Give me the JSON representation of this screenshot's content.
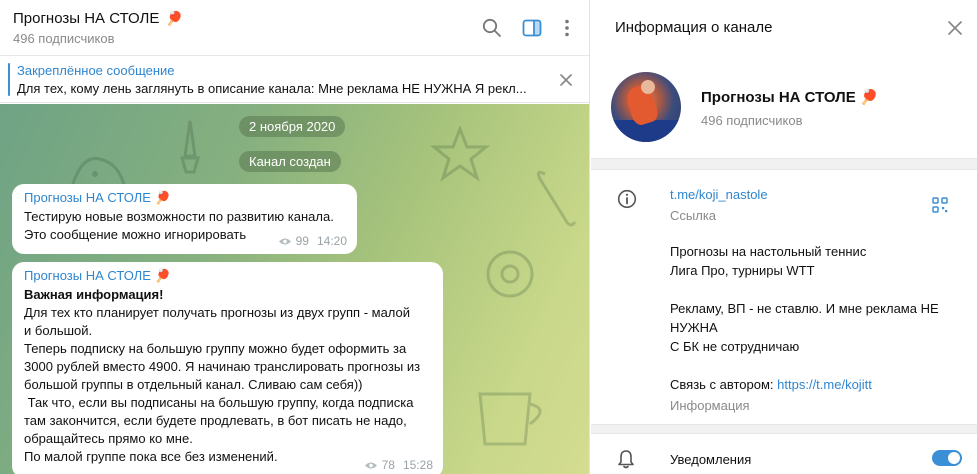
{
  "chat": {
    "title": "Прогнозы НА СТОЛЕ",
    "title_emoji": "🏓",
    "subscribers": "496 подписчиков",
    "pinned": {
      "title": "Закреплённое сообщение",
      "text": "Для тех, кому лень заглянуть в описание канала:  Мне реклама НЕ НУЖНА Я рекл..."
    },
    "date_pill": "2 ноября 2020",
    "service_pill": "Канал создан",
    "messages": [
      {
        "author": "Прогнозы НА СТОЛЕ",
        "author_emoji": "🏓",
        "lines": [
          "Тестирую новые возможности по развитию канала.",
          "Это сообщение можно игнорировать"
        ],
        "views": "99",
        "time": "14:20"
      },
      {
        "author": "Прогнозы НА СТОЛЕ",
        "author_emoji": "🏓",
        "heading": "Важная информация!",
        "lines": [
          "Для тех кто планирует получать прогнозы из двух групп - малой",
          "и большой.",
          "Теперь подписку на большую группу можно будет оформить за",
          "3000 рублей вместо 4900. Я начинаю транслировать прогнозы из",
          "большой группы в отдельный канал. Сливаю сам себя))",
          " Так что, если вы подписаны на большую группу, когда подписка",
          "там закончится, если будете продлевать, в бот писать не надо,",
          "обращайтесь прямо ко мне.",
          "По малой группе пока все без изменений."
        ],
        "views": "78",
        "time": "15:28"
      }
    ]
  },
  "info": {
    "header_title": "Информация о канале",
    "channel_name": "Прогнозы НА СТОЛЕ",
    "channel_emoji": "🏓",
    "subscribers": "496 подписчиков",
    "link": "t.me/koji_nastole",
    "link_caption": "Ссылка",
    "description": [
      "Прогнозы на настольный теннис",
      "Лига Про, турниры WTT",
      "",
      "Рекламу, ВП - не ставлю. И мне реклама НЕ",
      "НУЖНА",
      "С БК не сотрудничаю"
    ],
    "contact_prefix": "Связь с автором: ",
    "contact_link": "https://t.me/kojitt",
    "description_caption": "Информация",
    "notifications_label": "Уведомления",
    "notifications_on": true
  },
  "colors": {
    "accent": "#3a8fd6",
    "link": "#2f86cf",
    "muted": "#8a8a8a"
  },
  "icons": [
    "search-icon",
    "sidebar-toggle-icon",
    "more-vertical-icon",
    "close-icon",
    "info-icon",
    "qr-code-icon",
    "bell-icon",
    "eye-icon"
  ]
}
